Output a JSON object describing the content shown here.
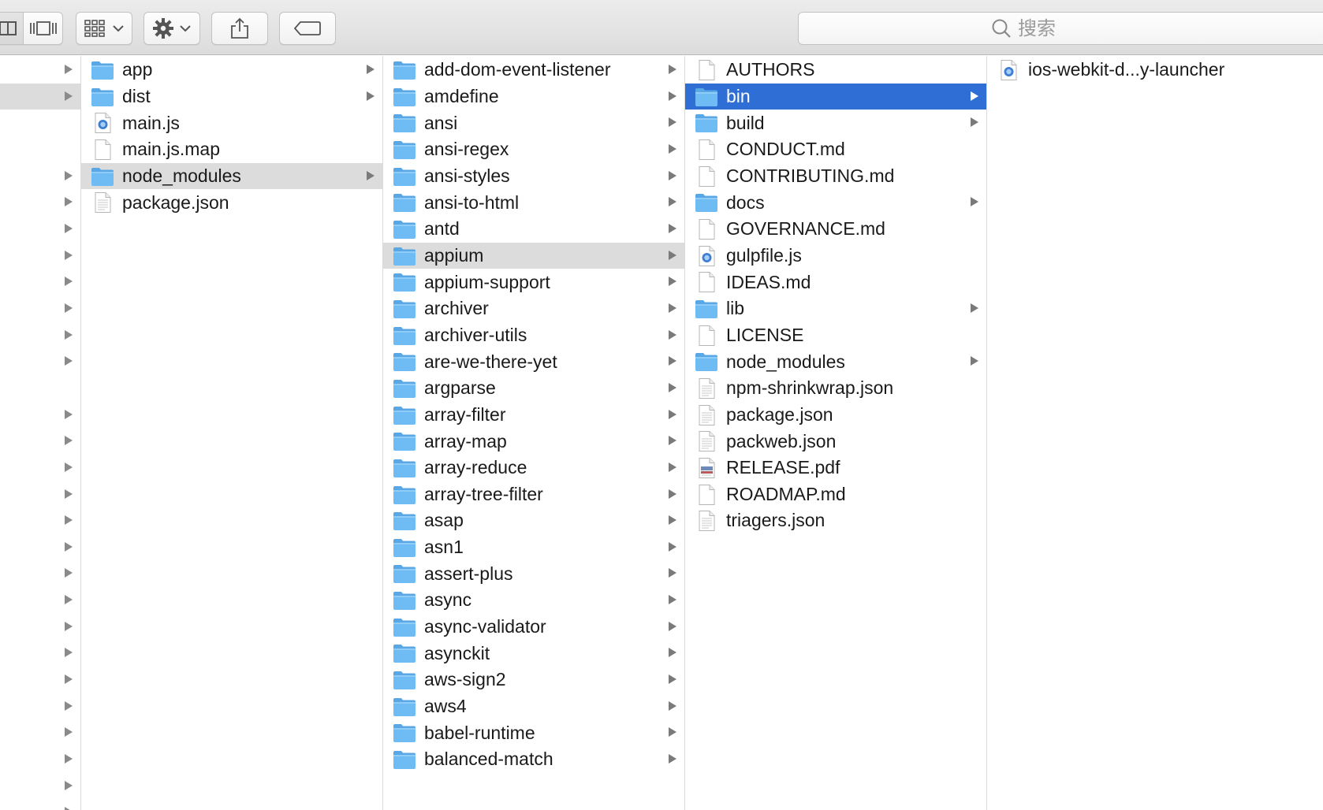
{
  "search": {
    "placeholder": "搜索"
  },
  "columns": [
    {
      "rows": [
        {
          "arrow": true
        },
        {
          "arrow": true,
          "selected": "gray"
        },
        {
          "arrow": false
        },
        {
          "arrow": false
        },
        {
          "arrow": true
        },
        {
          "arrow": true
        },
        {
          "arrow": true
        },
        {
          "arrow": true
        },
        {
          "arrow": true
        },
        {
          "arrow": true
        },
        {
          "arrow": true
        },
        {
          "arrow": true
        },
        {
          "arrow": false
        },
        {
          "arrow": true
        },
        {
          "arrow": true
        },
        {
          "arrow": true
        },
        {
          "arrow": true
        },
        {
          "arrow": true
        },
        {
          "arrow": true
        },
        {
          "arrow": true
        },
        {
          "arrow": true
        },
        {
          "arrow": true
        },
        {
          "arrow": true
        },
        {
          "arrow": true
        },
        {
          "arrow": true
        },
        {
          "arrow": true
        },
        {
          "arrow": true
        },
        {
          "arrow": true
        },
        {
          "arrow": true
        }
      ]
    },
    {
      "rows": [
        {
          "label": "app",
          "icon": "folder",
          "arrow": true
        },
        {
          "label": "dist",
          "icon": "folder",
          "arrow": true
        },
        {
          "label": "main.js",
          "icon": "js-file",
          "arrow": false
        },
        {
          "label": "main.js.map",
          "icon": "file",
          "arrow": false
        },
        {
          "label": "node_modules",
          "icon": "folder",
          "arrow": true,
          "selected": "gray"
        },
        {
          "label": "package.json",
          "icon": "text-file",
          "arrow": false
        }
      ]
    },
    {
      "rows": [
        {
          "label": "add-dom-event-listener",
          "icon": "folder",
          "arrow": true
        },
        {
          "label": "amdefine",
          "icon": "folder",
          "arrow": true
        },
        {
          "label": "ansi",
          "icon": "folder",
          "arrow": true
        },
        {
          "label": "ansi-regex",
          "icon": "folder",
          "arrow": true
        },
        {
          "label": "ansi-styles",
          "icon": "folder",
          "arrow": true
        },
        {
          "label": "ansi-to-html",
          "icon": "folder",
          "arrow": true
        },
        {
          "label": "antd",
          "icon": "folder",
          "arrow": true
        },
        {
          "label": "appium",
          "icon": "folder",
          "arrow": true,
          "selected": "gray"
        },
        {
          "label": "appium-support",
          "icon": "folder",
          "arrow": true
        },
        {
          "label": "archiver",
          "icon": "folder",
          "arrow": true
        },
        {
          "label": "archiver-utils",
          "icon": "folder",
          "arrow": true
        },
        {
          "label": "are-we-there-yet",
          "icon": "folder",
          "arrow": true
        },
        {
          "label": "argparse",
          "icon": "folder",
          "arrow": true
        },
        {
          "label": "array-filter",
          "icon": "folder",
          "arrow": true
        },
        {
          "label": "array-map",
          "icon": "folder",
          "arrow": true
        },
        {
          "label": "array-reduce",
          "icon": "folder",
          "arrow": true
        },
        {
          "label": "array-tree-filter",
          "icon": "folder",
          "arrow": true
        },
        {
          "label": "asap",
          "icon": "folder",
          "arrow": true
        },
        {
          "label": "asn1",
          "icon": "folder",
          "arrow": true
        },
        {
          "label": "assert-plus",
          "icon": "folder",
          "arrow": true
        },
        {
          "label": "async",
          "icon": "folder",
          "arrow": true
        },
        {
          "label": "async-validator",
          "icon": "folder",
          "arrow": true
        },
        {
          "label": "asynckit",
          "icon": "folder",
          "arrow": true
        },
        {
          "label": "aws-sign2",
          "icon": "folder",
          "arrow": true
        },
        {
          "label": "aws4",
          "icon": "folder",
          "arrow": true
        },
        {
          "label": "babel-runtime",
          "icon": "folder",
          "arrow": true
        },
        {
          "label": "balanced-match",
          "icon": "folder",
          "arrow": true
        }
      ]
    },
    {
      "rows": [
        {
          "label": "AUTHORS",
          "icon": "file",
          "arrow": false
        },
        {
          "label": "bin",
          "icon": "folder",
          "arrow": true,
          "selected": "blue"
        },
        {
          "label": "build",
          "icon": "folder",
          "arrow": true
        },
        {
          "label": "CONDUCT.md",
          "icon": "file",
          "arrow": false
        },
        {
          "label": "CONTRIBUTING.md",
          "icon": "file",
          "arrow": false
        },
        {
          "label": "docs",
          "icon": "folder",
          "arrow": true
        },
        {
          "label": "GOVERNANCE.md",
          "icon": "file",
          "arrow": false
        },
        {
          "label": "gulpfile.js",
          "icon": "js-file",
          "arrow": false
        },
        {
          "label": "IDEAS.md",
          "icon": "file",
          "arrow": false
        },
        {
          "label": "lib",
          "icon": "folder",
          "arrow": true
        },
        {
          "label": "LICENSE",
          "icon": "file",
          "arrow": false
        },
        {
          "label": "node_modules",
          "icon": "folder",
          "arrow": true
        },
        {
          "label": "npm-shrinkwrap.json",
          "icon": "text-file",
          "arrow": false
        },
        {
          "label": "package.json",
          "icon": "text-file",
          "arrow": false
        },
        {
          "label": "packweb.json",
          "icon": "text-file",
          "arrow": false
        },
        {
          "label": "RELEASE.pdf",
          "icon": "pdf-file",
          "arrow": false
        },
        {
          "label": "ROADMAP.md",
          "icon": "file",
          "arrow": false
        },
        {
          "label": "triagers.json",
          "icon": "text-file",
          "arrow": false
        }
      ]
    },
    {
      "rows": [
        {
          "label": "ios-webkit-d...y-launcher",
          "icon": "js-file",
          "arrow": false
        }
      ]
    }
  ],
  "colors": {
    "selection_blue": "#2f6fd5",
    "selection_gray": "#dcdcdc",
    "folder_blue": "#69b6f2"
  }
}
